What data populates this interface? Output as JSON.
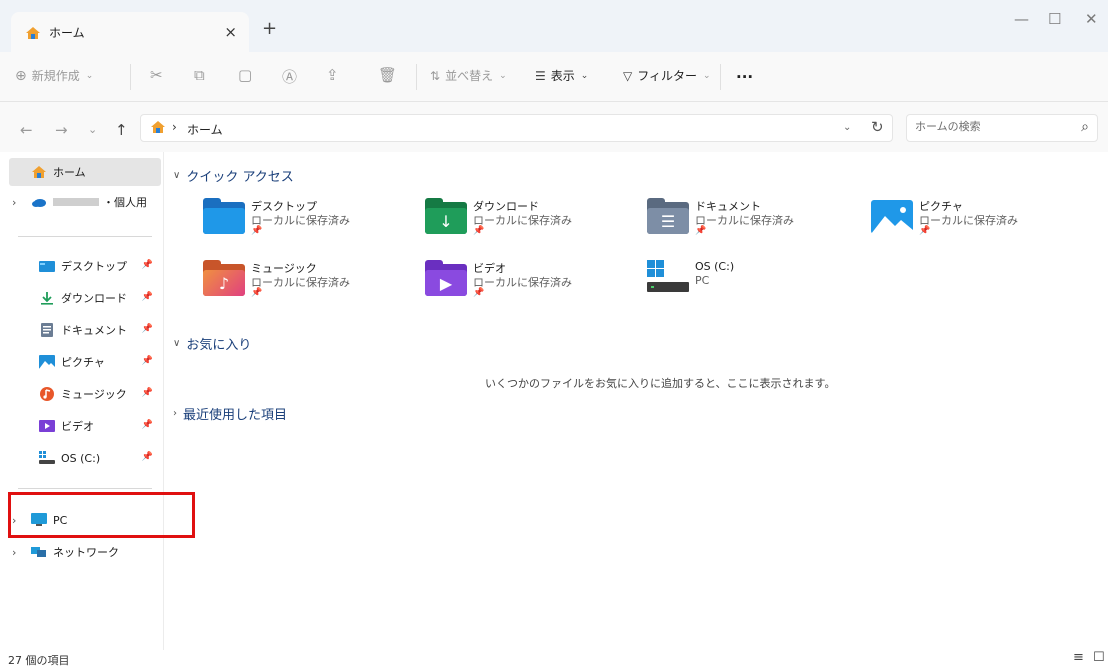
{
  "window": {
    "tab_title": "ホーム",
    "tab_close": "×",
    "tab_add": "+",
    "minimize": "—",
    "maximize": "☐",
    "close": "✕"
  },
  "toolbar": {
    "new_label": "新規作成",
    "sort_label": "並べ替え",
    "view_label": "表示",
    "filter_label": "フィルター",
    "more_label": "..."
  },
  "address": {
    "path": "ホーム",
    "search_placeholder": "ホームの検索"
  },
  "sidebar": {
    "home": "ホーム",
    "onedrive": "・個人用",
    "pinned": [
      {
        "label": "デスクトップ"
      },
      {
        "label": "ダウンロード"
      },
      {
        "label": "ドキュメント"
      },
      {
        "label": "ピクチャ"
      },
      {
        "label": "ミュージック"
      },
      {
        "label": "ビデオ"
      },
      {
        "label": "OS (C:)"
      }
    ],
    "pc": "PC",
    "network": "ネットワーク"
  },
  "content": {
    "quick_access": "クイック アクセス",
    "favorites": "お気に入り",
    "recent": "最近使用した項目",
    "favorites_empty": "いくつかのファイルをお気に入りに追加すると、ここに表示されます。",
    "items": [
      {
        "name": "デスクトップ",
        "sub": "ローカルに保存済み"
      },
      {
        "name": "ダウンロード",
        "sub": "ローカルに保存済み"
      },
      {
        "name": "ドキュメント",
        "sub": "ローカルに保存済み"
      },
      {
        "name": "ピクチャ",
        "sub": "ローカルに保存済み"
      },
      {
        "name": "ミュージック",
        "sub": "ローカルに保存済み"
      },
      {
        "name": "ビデオ",
        "sub": "ローカルに保存済み"
      },
      {
        "name": "OS (C:)",
        "sub": "PC"
      }
    ]
  },
  "status": {
    "count": "27 個の項目"
  }
}
